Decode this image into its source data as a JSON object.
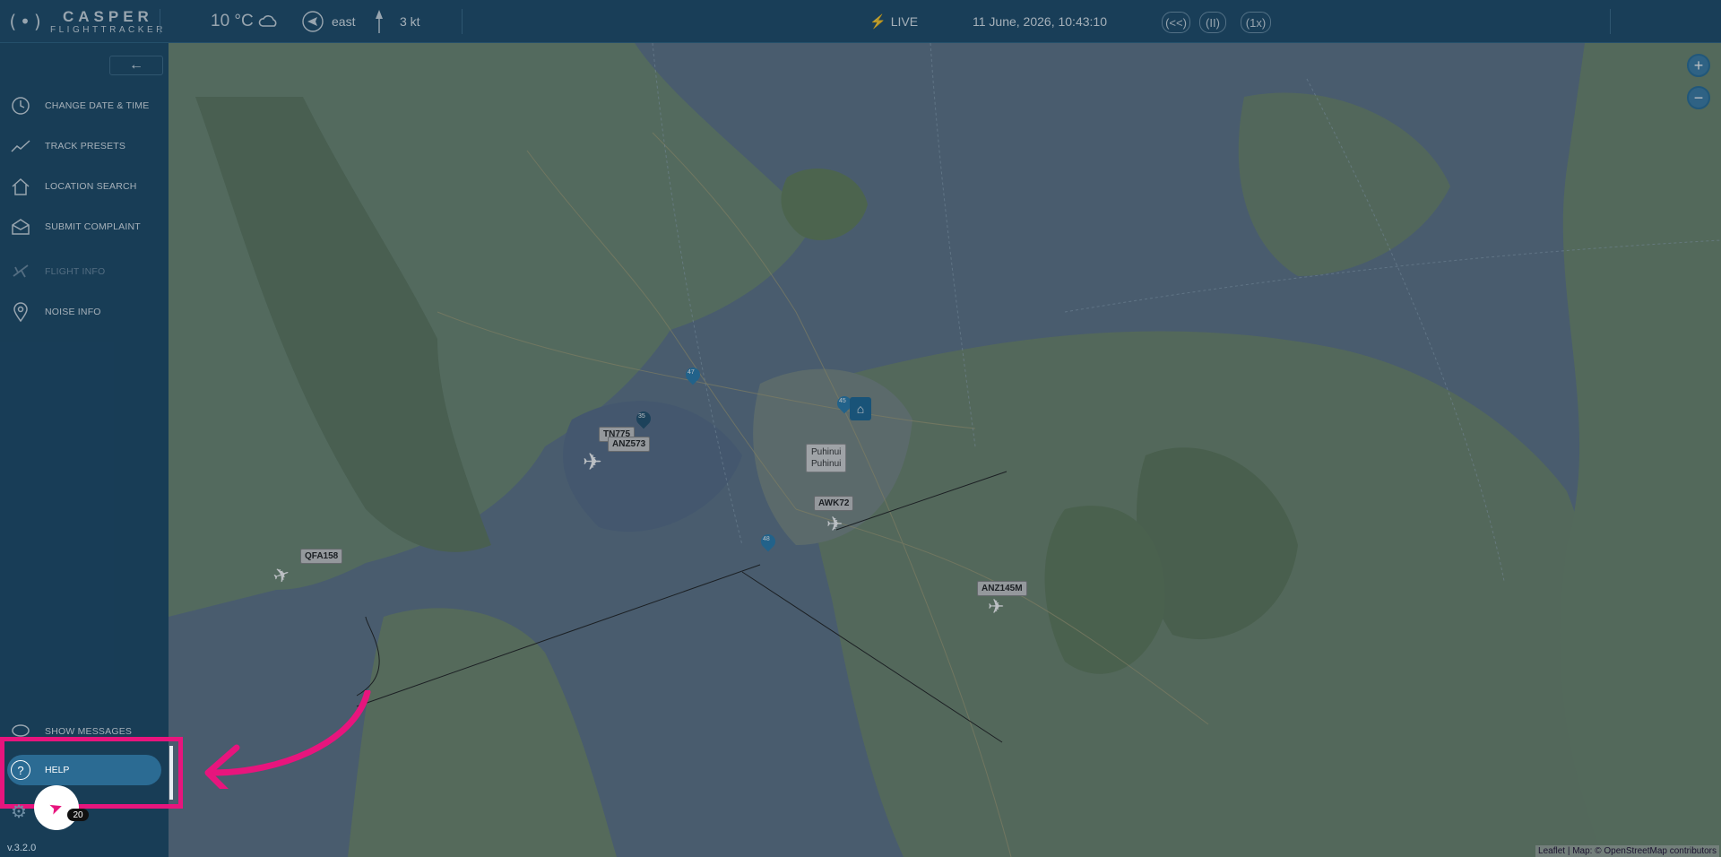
{
  "app": {
    "logo_symbol": "(•)",
    "brand_line1": "CASPER",
    "brand_line2": "FLIGHTTRACKER",
    "version": "v.3.2.0"
  },
  "weather": {
    "temperature": "10 °C",
    "icon": "partly-cloudy-icon",
    "wind_direction": "east",
    "wind_speed": "3 kt"
  },
  "status": {
    "live_label": "LIVE",
    "datetime": "11 June, 2026, 10:43:10"
  },
  "playback": {
    "rewind_label": "(<<)",
    "pause_label": "(II)",
    "speed_label": "(1x)"
  },
  "sidebar": {
    "items": [
      {
        "label": "CHANGE DATE & TIME",
        "icon": "clock-icon"
      },
      {
        "label": "TRACK PRESETS",
        "icon": "chart-line-icon"
      },
      {
        "label": "LOCATION SEARCH",
        "icon": "home-icon"
      },
      {
        "label": "SUBMIT COMPLAINT",
        "icon": "envelope-icon"
      },
      {
        "label": "FLIGHT INFO",
        "icon": "plane-icon",
        "disabled": true
      },
      {
        "label": "NOISE INFO",
        "icon": "map-pin-icon"
      }
    ],
    "bottom": {
      "messages_label": "SHOW MESSAGES",
      "help_label": "HELP",
      "notification_count": "20"
    }
  },
  "map": {
    "flights": [
      "ANZ573",
      "TN775",
      "AWK72",
      "QFA158",
      "ANZ145M"
    ],
    "place_label_line1": "Puhinui",
    "place_label_line2": "Puhinui",
    "markers": [
      "47",
      "35",
      "45",
      "48"
    ],
    "zoom_in": "+",
    "zoom_out": "−",
    "attribution": "Leaflet | Map: © OpenStreetMap contributors"
  },
  "colors": {
    "highlight": "#e7157d",
    "sidebar": "#1e4b69",
    "topbar": "#1f4d6b"
  }
}
